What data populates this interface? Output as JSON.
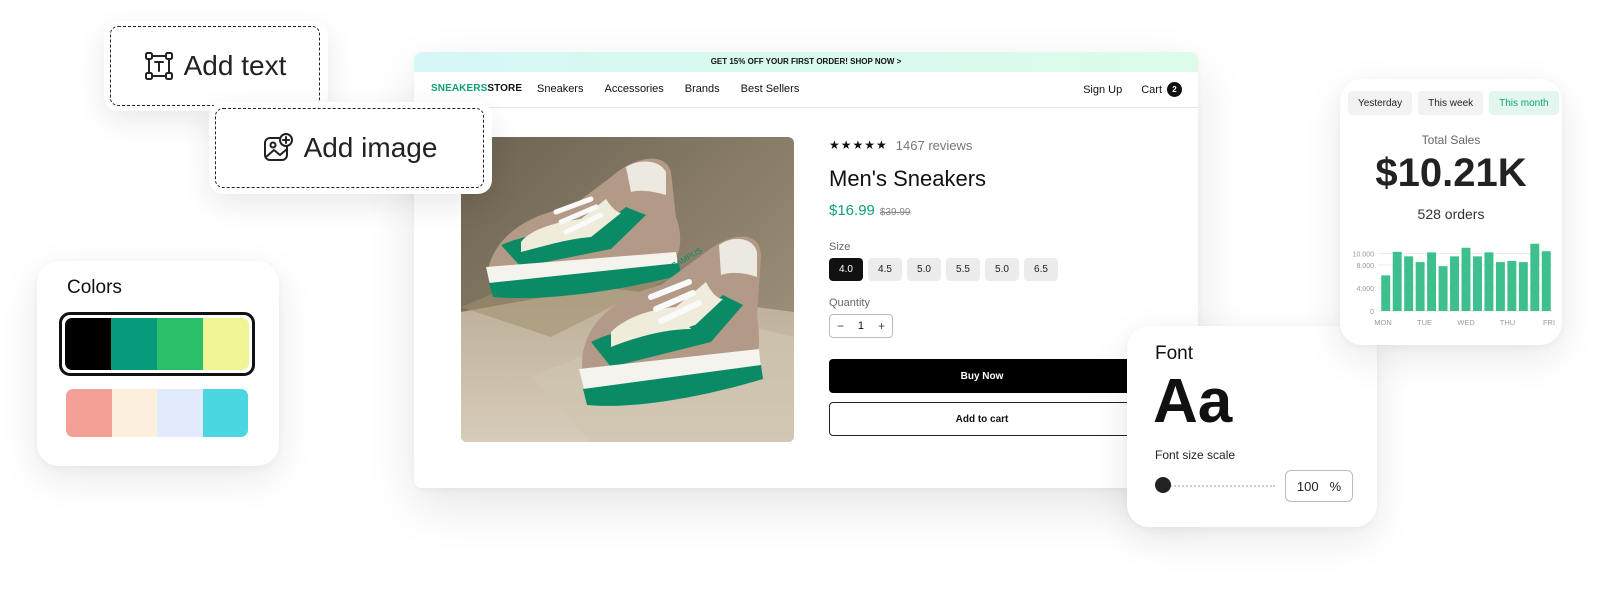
{
  "store": {
    "promo": "GET 15% OFF YOUR FIRST ORDER! SHOP NOW >",
    "logo_part1": "SNEAKERS",
    "logo_part2": "STORE",
    "nav": [
      "Sneakers",
      "Accessories",
      "Brands",
      "Best Sellers"
    ],
    "sign_up": "Sign Up",
    "cart_label": "Cart",
    "cart_count": "2",
    "product": {
      "stars": "★★★★★",
      "reviews": "1467 reviews",
      "title": "Men's Sneakers",
      "price": "$16.99",
      "old_price": "$39.99",
      "size_label": "Size",
      "sizes": [
        "4.0",
        "4.5",
        "5.0",
        "5.5",
        "5.0",
        "6.5"
      ],
      "selected_size_index": 0,
      "quantity_label": "Quantity",
      "quantity": "1",
      "qty_minus": "−",
      "qty_plus": "+",
      "buy_now": "Buy Now",
      "add_to_cart": "Add to cart",
      "shoe_brand_text": "CAMPUS",
      "colors": {
        "accent": "#0f9f79",
        "shoe_green": "#0b8a66",
        "shoe_tan": "#b39a86"
      }
    }
  },
  "add_text": {
    "label": "Add text",
    "icon": "text-box-icon"
  },
  "add_image": {
    "label": "Add image",
    "icon": "image-add-icon"
  },
  "colors_panel": {
    "title": "Colors",
    "palette_selected": [
      "#000000",
      "#089b7b",
      "#2bbf6a",
      "#eef595"
    ],
    "palette_2": [
      "#f5a096",
      "#fdefde",
      "#e1ebfb",
      "#4ad7e1"
    ]
  },
  "font_panel": {
    "title": "Font",
    "sample": "Aa",
    "scale_label": "Font size scale",
    "scale_value": "100",
    "scale_unit": "%",
    "scale_fraction": 0
  },
  "sales_panel": {
    "tabs": [
      "Yesterday",
      "This week",
      "This month"
    ],
    "active_tab_index": 2,
    "total_label": "Total Sales",
    "total_value": "$10.21K",
    "orders": "528 orders",
    "chart_data": {
      "type": "bar",
      "y_ticks": [
        "10.000",
        "8.000",
        "4.000",
        "0"
      ],
      "x_labels": [
        "MON",
        "TUE",
        "WED",
        "THU",
        "FRI"
      ],
      "values": [
        6200,
        10300,
        9500,
        8500,
        10200,
        7800,
        9500,
        11000,
        9500,
        10200,
        8500,
        8700,
        8500,
        11700,
        10400
      ],
      "ylim": [
        0,
        12000
      ],
      "color": "#3dbf8e"
    }
  }
}
